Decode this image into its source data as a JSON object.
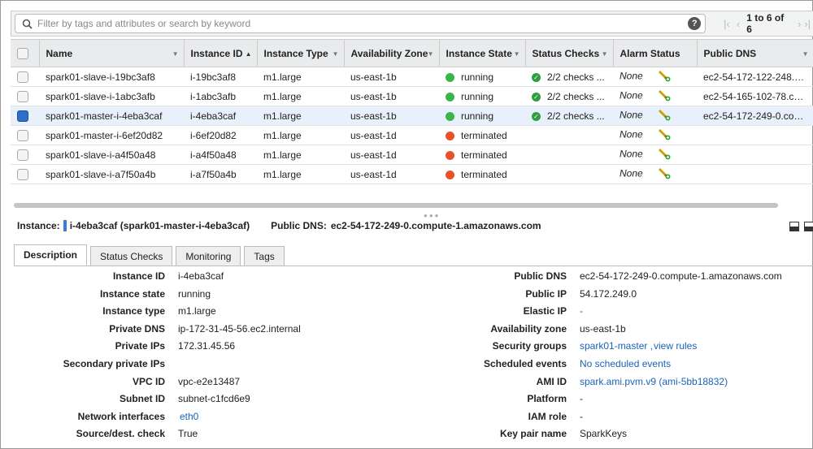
{
  "search": {
    "placeholder": "Filter by tags and attributes or search by keyword"
  },
  "pager": {
    "count_text": "1 to 6 of 6"
  },
  "columns": [
    "Name",
    "Instance ID",
    "Instance Type",
    "Availability Zone",
    "Instance State",
    "Status Checks",
    "Alarm Status",
    "Public DNS"
  ],
  "rows": [
    {
      "name": "spark01-slave-i-19bc3af8",
      "id": "i-19bc3af8",
      "type": "m1.large",
      "zone": "us-east-1b",
      "state": "running",
      "state_color": "green",
      "checks": "2/2 checks ...",
      "alarm": "None",
      "dns": "ec2-54-172-122-248.com...",
      "selected": false
    },
    {
      "name": "spark01-slave-i-1abc3afb",
      "id": "i-1abc3afb",
      "type": "m1.large",
      "zone": "us-east-1b",
      "state": "running",
      "state_color": "green",
      "checks": "2/2 checks ...",
      "alarm": "None",
      "dns": "ec2-54-165-102-78.co...",
      "selected": false
    },
    {
      "name": "spark01-master-i-4eba3caf",
      "id": "i-4eba3caf",
      "type": "m1.large",
      "zone": "us-east-1b",
      "state": "running",
      "state_color": "green",
      "checks": "2/2 checks ...",
      "alarm": "None",
      "dns": "ec2-54-172-249-0.com...",
      "selected": true
    },
    {
      "name": "spark01-master-i-6ef20d82",
      "id": "i-6ef20d82",
      "type": "m1.large",
      "zone": "us-east-1d",
      "state": "terminated",
      "state_color": "red",
      "checks": "",
      "alarm": "None",
      "dns": "",
      "selected": false
    },
    {
      "name": "spark01-slave-i-a4f50a48",
      "id": "i-a4f50a48",
      "type": "m1.large",
      "zone": "us-east-1d",
      "state": "terminated",
      "state_color": "red",
      "checks": "",
      "alarm": "None",
      "dns": "",
      "selected": false
    },
    {
      "name": "spark01-slave-i-a7f50a4b",
      "id": "i-a7f50a4b",
      "type": "m1.large",
      "zone": "us-east-1d",
      "state": "terminated",
      "state_color": "red",
      "checks": "",
      "alarm": "None",
      "dns": "",
      "selected": false
    }
  ],
  "instance_header": {
    "label": "Instance:",
    "value": "i-4eba3caf (spark01-master-i-4eba3caf)",
    "dns_label": "Public DNS:",
    "dns_value": "ec2-54-172-249-0.compute-1.amazonaws.com"
  },
  "tabs": [
    "Description",
    "Status Checks",
    "Monitoring",
    "Tags"
  ],
  "details_left": [
    {
      "label": "Instance ID",
      "value": "i-4eba3caf",
      "link": false
    },
    {
      "label": "Instance state",
      "value": "running",
      "link": false
    },
    {
      "label": "Instance type",
      "value": "m1.large",
      "link": false
    },
    {
      "label": "Private DNS",
      "value": "ip-172-31-45-56.ec2.internal",
      "link": false
    },
    {
      "label": "Private IPs",
      "value": "172.31.45.56",
      "link": false
    },
    {
      "label": "Secondary private IPs",
      "value": "",
      "link": false
    },
    {
      "label": "VPC ID",
      "value": "vpc-e2e13487",
      "link": false
    },
    {
      "label": "Subnet ID",
      "value": "subnet-c1fcd6e9",
      "link": false
    },
    {
      "label": "Network interfaces",
      "value": "eth0",
      "link": true
    },
    {
      "label": "Source/dest. check",
      "value": "True",
      "link": false
    }
  ],
  "details_right": [
    {
      "label": "Public DNS",
      "value": "ec2-54-172-249-0.compute-1.amazonaws.com",
      "link": false
    },
    {
      "label": "Public IP",
      "value": "54.172.249.0",
      "link": false
    },
    {
      "label": "Elastic IP",
      "value": "-",
      "link": true
    },
    {
      "label": "Availability zone",
      "value": "us-east-1b",
      "link": false
    },
    {
      "label": "Security groups",
      "value": "spark01-master",
      "value2": "view rules",
      "link": true
    },
    {
      "label": "Scheduled events",
      "value": "No scheduled events",
      "link": true
    },
    {
      "label": "AMI ID",
      "value": "spark.ami.pvm.v9 (ami-5bb18832)",
      "link": true
    },
    {
      "label": "Platform",
      "value": "-",
      "link": false
    },
    {
      "label": "IAM role",
      "value": "-",
      "link": false
    },
    {
      "label": "Key pair name",
      "value": "SparkKeys",
      "link": false
    }
  ]
}
